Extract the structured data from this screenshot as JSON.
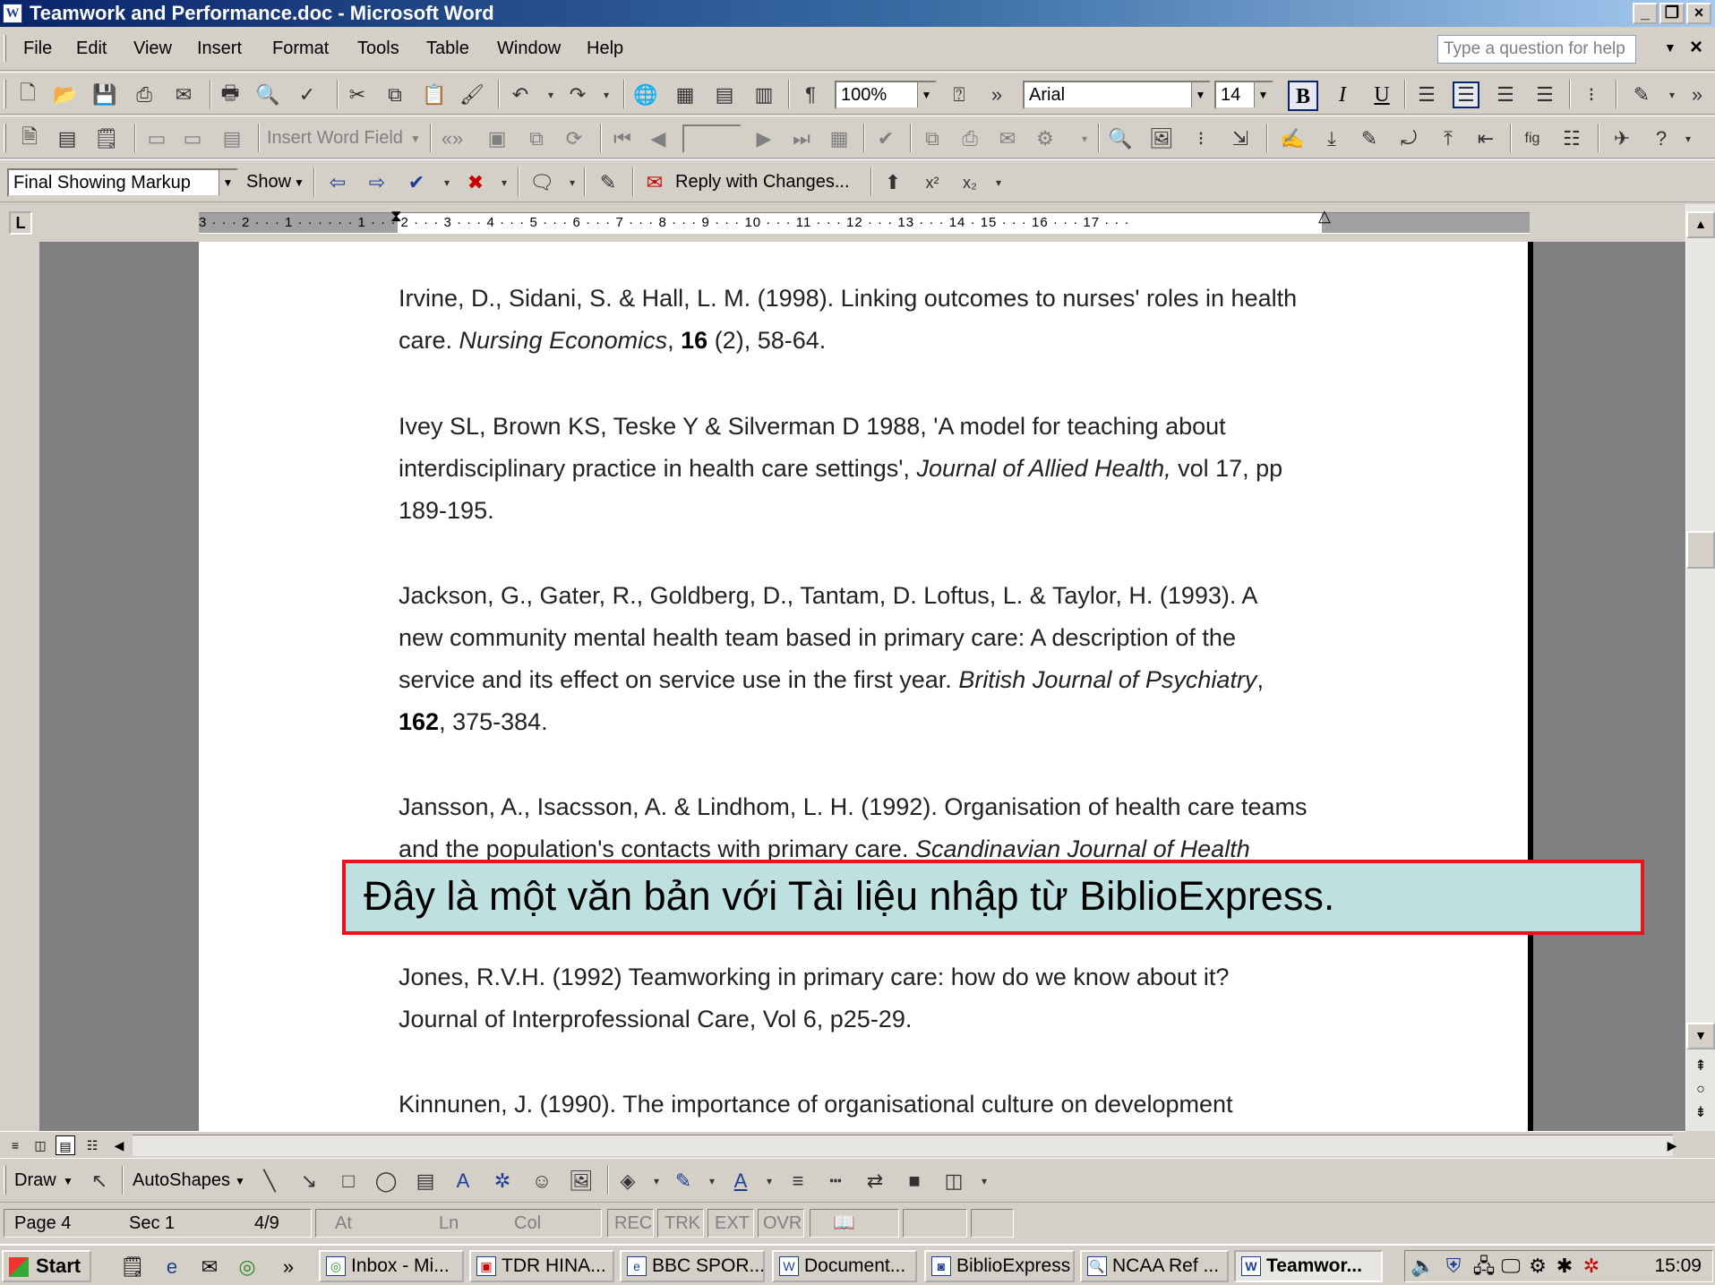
{
  "window": {
    "title": "Teamwork and Performance.doc - Microsoft Word",
    "app_icon": "W",
    "minimize": "_",
    "restore": "❐",
    "close": "×"
  },
  "menu": {
    "items": [
      "File",
      "Edit",
      "View",
      "Insert",
      "Format",
      "Tools",
      "Table",
      "Window",
      "Help"
    ],
    "help_placeholder": "Type a question for help"
  },
  "standard_toolbar": {
    "zoom": "100%",
    "font": "Arial",
    "font_size": "14",
    "bold": "B",
    "italic": "I",
    "underline": "U"
  },
  "review_toolbar": {
    "insert_word_field": "Insert Word Field",
    "display": "Final Showing Markup",
    "show": "Show",
    "reply": "Reply with Changes..."
  },
  "ruler": {
    "numbers": "3 · · · 2 · · · 1 · · ·   · · · 1 · · · 2 · · · 3 · · · 4 · · · 5 · · · 6 · · · 7 · · · 8 · · · 9 · · · 10 · · · 11 · · · 12 · · · 13 · · · 14 ·   15 · · · 16 · · · 17 · · ·"
  },
  "document": {
    "references": [
      {
        "lines": [
          "Irvine, D., Sidani, S. & Hall, L. M. (1998). Linking outcomes to nurses' roles in health",
          "care. "
        ],
        "journal": "Nursing Economics",
        "volume": "16",
        "tail": " (2), 58-64."
      },
      {
        "line1": "Ivey SL, Brown KS, Teske Y & Silverman D 1988, 'A model for teaching about",
        "line2_pre": "interdisciplinary practice in health care settings', ",
        "journal": "Journal of Allied Health,",
        "line2_post": " vol 17, pp",
        "line3": "189-195."
      },
      {
        "line1": "Jackson, G., Gater, R., Goldberg, D., Tantam, D. Loftus, L. & Taylor, H. (1993). A",
        "line2": "new community mental health team based in primary care: A description of the",
        "line3_pre": "service and its effect on service use in the first year. ",
        "journal": "British Journal of Psychiatry",
        "line3_post": ",",
        "volume": "162",
        "tail": ", 375-384."
      },
      {
        "line1": "Jansson, A., Isacsson, A. & Lindhom, L. H. (1992). Organisation of health care teams",
        "line2_pre": "and the population's contacts with primary care. ",
        "journal": "Scandinavian Journal of Health"
      },
      {
        "line1": "Jones, R.V.H. (1992) Teamworking in primary care: how do we know about it?",
        "line2": "Journal of Interprofessional Care, Vol 6, p25-29."
      },
      {
        "line1": "Kinnunen, J. (1990). The importance of organisational culture on development"
      }
    ]
  },
  "caption": "Đây là một văn bản với Tài liệu nhập từ BiblioExpress.",
  "drawing_toolbar": {
    "draw": "Draw",
    "autoshapes": "AutoShapes"
  },
  "status": {
    "page": "Page 4",
    "sec": "Sec 1",
    "count": "4/9",
    "at": "At",
    "ln": "Ln",
    "col": "Col",
    "rec": "REC",
    "trk": "TRK",
    "ext": "EXT",
    "ovr": "OVR"
  },
  "taskbar": {
    "start": "Start",
    "tasks": [
      "Inbox - Mi...",
      "TDR HINA...",
      "BBC SPOR...",
      "Document...",
      "BiblioExpress",
      "NCAA Ref ...",
      "Teamwor..."
    ],
    "clock": "15:09"
  },
  "colors": {
    "caption_border": "#e8141c",
    "caption_bg": "#bfe0e0",
    "titlebar": "#0a246a"
  }
}
